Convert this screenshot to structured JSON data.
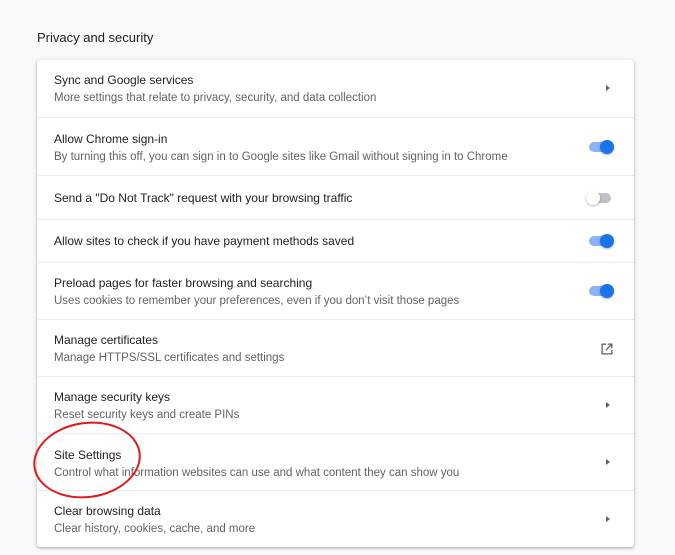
{
  "section": {
    "title": "Privacy and security"
  },
  "rows": [
    {
      "primary": "Sync and Google services",
      "secondary": "More settings that relate to privacy, security, and data collection",
      "control": "arrow"
    },
    {
      "primary": "Allow Chrome sign-in",
      "secondary": "By turning this off, you can sign in to Google sites like Gmail without signing in to Chrome",
      "control": "toggle",
      "checked": true
    },
    {
      "primary": "Send a \"Do Not Track\" request with your browsing traffic",
      "secondary": "",
      "control": "toggle",
      "checked": false
    },
    {
      "primary": "Allow sites to check if you have payment methods saved",
      "secondary": "",
      "control": "toggle",
      "checked": true
    },
    {
      "primary": "Preload pages for faster browsing and searching",
      "secondary": "Uses cookies to remember your preferences, even if you don’t visit those pages",
      "control": "toggle",
      "checked": true
    },
    {
      "primary": "Manage certificates",
      "secondary": "Manage HTTPS/SSL certificates and settings",
      "control": "external-link-icon"
    },
    {
      "primary": "Manage security keys",
      "secondary": "Reset security keys and create PINs",
      "control": "arrow"
    },
    {
      "primary": "Site Settings",
      "secondary": "Control what information websites can use and what content they can show you",
      "control": "arrow"
    },
    {
      "primary": "Clear browsing data",
      "secondary": "Clear history, cookies, cache, and more",
      "control": "arrow"
    }
  ],
  "colors": {
    "toggle_on": "#1a73e8",
    "toggle_on_track": "#8ab4f8",
    "annotation": "#e01b1b"
  }
}
